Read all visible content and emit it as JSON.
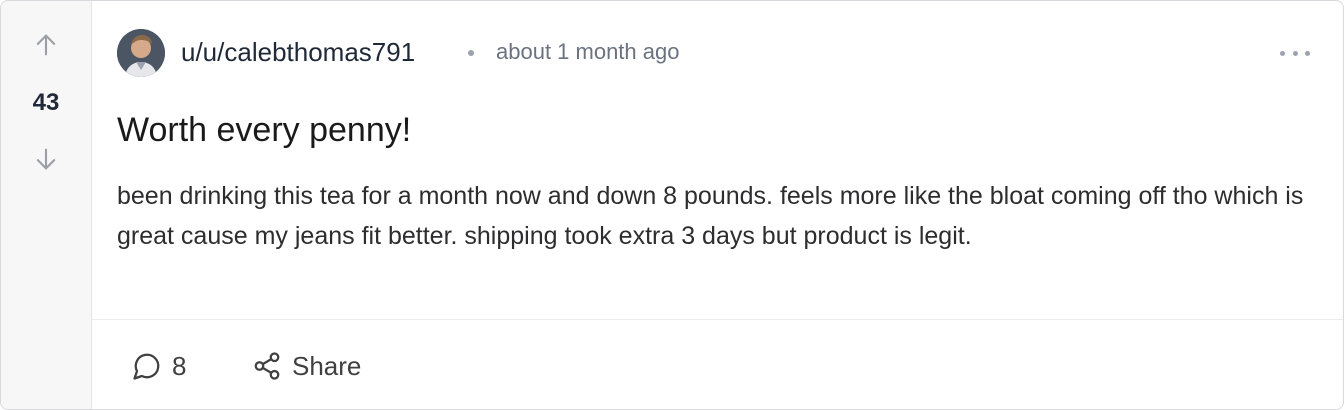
{
  "post": {
    "score": "43",
    "author": "u/u/calebthomas791",
    "time": "about 1 month ago",
    "title": "Worth every penny!",
    "body": "been drinking this tea for a month now and down 8 pounds. feels more like the bloat coming off tho which is great cause my jeans fit better. shipping took extra 3 days but product is legit.",
    "comments_count": "8",
    "share_label": "Share"
  },
  "icons": {
    "upvote": "arrow-up-icon",
    "downvote": "arrow-down-icon",
    "more": "more-horizontal-icon",
    "comment": "comment-bubble-icon",
    "share": "share-icon"
  },
  "colors": {
    "vote_column_bg": "#f7f7f8",
    "muted_text": "#6b7280",
    "border": "#d9d9dd"
  }
}
